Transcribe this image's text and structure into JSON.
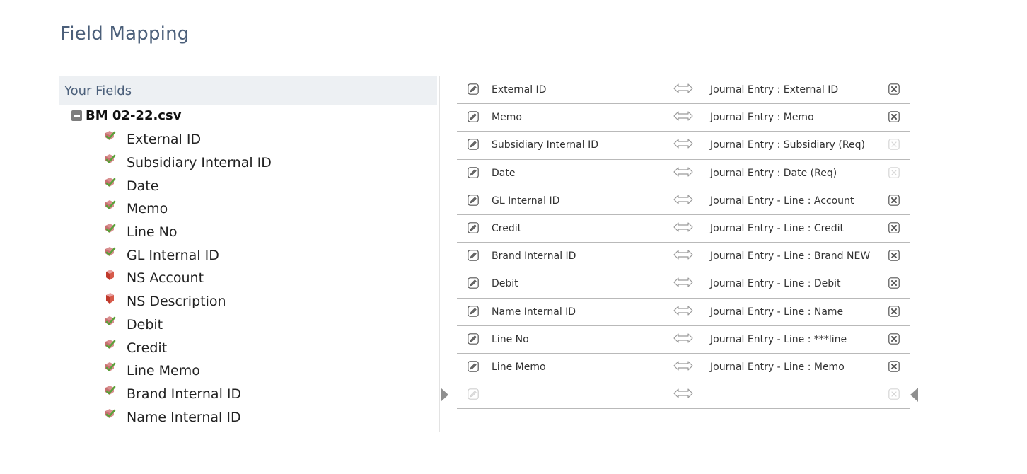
{
  "page_title": "Field Mapping",
  "left_panel": {
    "header": "Your Fields",
    "file_name": "BM 02-22.csv",
    "fields": [
      {
        "label": "External ID",
        "icon": "mapped-field-icon",
        "mapped": true
      },
      {
        "label": "Subsidiary Internal ID",
        "icon": "mapped-field-icon",
        "mapped": true
      },
      {
        "label": "Date",
        "icon": "mapped-field-icon",
        "mapped": true
      },
      {
        "label": "Memo",
        "icon": "mapped-field-icon",
        "mapped": true
      },
      {
        "label": "Line No",
        "icon": "mapped-field-icon",
        "mapped": true
      },
      {
        "label": "GL Internal ID",
        "icon": "mapped-field-icon",
        "mapped": true
      },
      {
        "label": "NS Account",
        "icon": "unmapped-field-icon",
        "mapped": false
      },
      {
        "label": "NS Description",
        "icon": "unmapped-field-icon",
        "mapped": false
      },
      {
        "label": "Debit",
        "icon": "mapped-field-icon",
        "mapped": true
      },
      {
        "label": "Credit",
        "icon": "mapped-field-icon",
        "mapped": true
      },
      {
        "label": "Line Memo",
        "icon": "mapped-field-icon",
        "mapped": true
      },
      {
        "label": "Brand Internal ID",
        "icon": "mapped-field-icon",
        "mapped": true
      },
      {
        "label": "Name Internal ID",
        "icon": "mapped-field-icon",
        "mapped": true
      }
    ]
  },
  "mappings": [
    {
      "source": "External ID",
      "target": "Journal Entry : External ID",
      "removable": true
    },
    {
      "source": "Memo",
      "target": "Journal Entry : Memo",
      "removable": true
    },
    {
      "source": "Subsidiary Internal ID",
      "target": "Journal Entry : Subsidiary (Req)",
      "removable": false
    },
    {
      "source": "Date",
      "target": "Journal Entry : Date (Req)",
      "removable": false
    },
    {
      "source": "GL Internal ID",
      "target": "Journal Entry - Line : Account",
      "removable": true
    },
    {
      "source": "Credit",
      "target": "Journal Entry - Line : Credit",
      "removable": true
    },
    {
      "source": "Brand Internal ID",
      "target": "Journal Entry - Line : Brand NEW",
      "removable": true
    },
    {
      "source": "Debit",
      "target": "Journal Entry - Line : Debit",
      "removable": true
    },
    {
      "source": "Name Internal ID",
      "target": "Journal Entry - Line : Name",
      "removable": true
    },
    {
      "source": "Line No",
      "target": "Journal Entry - Line : ***line",
      "removable": true
    },
    {
      "source": "Line Memo",
      "target": "Journal Entry - Line : Memo",
      "removable": true
    },
    {
      "source": "",
      "target": "",
      "removable": false
    }
  ],
  "colors": {
    "title": "#4b5f7a",
    "header_bg": "#edf0f3",
    "row_border": "#b9b9b9",
    "mapped_icon": "#6fa84a",
    "unmapped_icon": "#c0392b"
  }
}
